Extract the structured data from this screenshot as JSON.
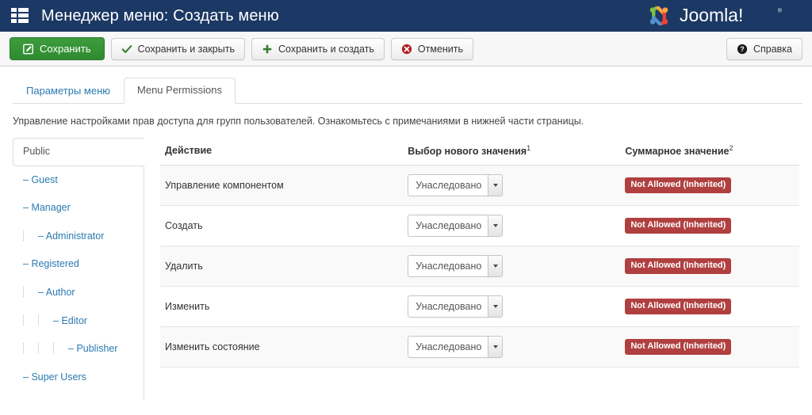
{
  "header": {
    "title": "Менеджер меню: Создать меню",
    "menu_icon": "th-list-icon",
    "logo_text": "Joomla!",
    "logo_tm": "®",
    "bg_color": "#1c3864"
  },
  "toolbar": {
    "buttons": [
      {
        "label": "Сохранить",
        "icon": "edit-square-icon",
        "style": "success"
      },
      {
        "label": "Сохранить и закрыть",
        "icon": "check-icon",
        "style": "default"
      },
      {
        "label": "Сохранить и создать",
        "icon": "plus-icon",
        "style": "default"
      },
      {
        "label": "Отменить",
        "icon": "cancel-circle-icon",
        "style": "default"
      }
    ],
    "help": {
      "label": "Справка",
      "icon": "question-circle-icon"
    }
  },
  "tabs": [
    {
      "label": "Параметры меню",
      "active": false
    },
    {
      "label": "Menu Permissions",
      "active": true
    }
  ],
  "description": "Управление настройками прав доступа для групп пользователей. Ознакомьтесь с примечаниями в нижней части страницы.",
  "group_tabs": [
    {
      "label": "Public",
      "indent": 0,
      "active": true,
      "dash": false
    },
    {
      "label": "Guest",
      "indent": 0,
      "active": false,
      "dash": true
    },
    {
      "label": "Manager",
      "indent": 0,
      "active": false,
      "dash": true
    },
    {
      "label": "Administrator",
      "indent": 1,
      "active": false,
      "dash": true
    },
    {
      "label": "Registered",
      "indent": 0,
      "active": false,
      "dash": true
    },
    {
      "label": "Author",
      "indent": 1,
      "active": false,
      "dash": true
    },
    {
      "label": "Editor",
      "indent": 2,
      "active": false,
      "dash": true
    },
    {
      "label": "Publisher",
      "indent": 3,
      "active": false,
      "dash": true
    },
    {
      "label": "Super Users",
      "indent": 0,
      "active": false,
      "dash": true
    }
  ],
  "table": {
    "headers": {
      "action": "Действие",
      "select": "Выбор нового значения",
      "select_sup": "1",
      "calculated": "Суммарное значение",
      "calculated_sup": "2"
    },
    "rows": [
      {
        "action": "Управление компонентом",
        "value": "Унаследовано",
        "calculated": "Not Allowed (Inherited)"
      },
      {
        "action": "Создать",
        "value": "Унаследовано",
        "calculated": "Not Allowed (Inherited)"
      },
      {
        "action": "Удалить",
        "value": "Унаследовано",
        "calculated": "Not Allowed (Inherited)"
      },
      {
        "action": "Изменить",
        "value": "Унаследовано",
        "calculated": "Not Allowed (Inherited)"
      },
      {
        "action": "Изменить состояние",
        "value": "Унаследовано",
        "calculated": "Not Allowed (Inherited)"
      }
    ]
  },
  "colors": {
    "header_bg": "#1c3864",
    "link": "#2a7ab0",
    "success": "#2f8a2f",
    "badge_danger": "#b04040"
  }
}
